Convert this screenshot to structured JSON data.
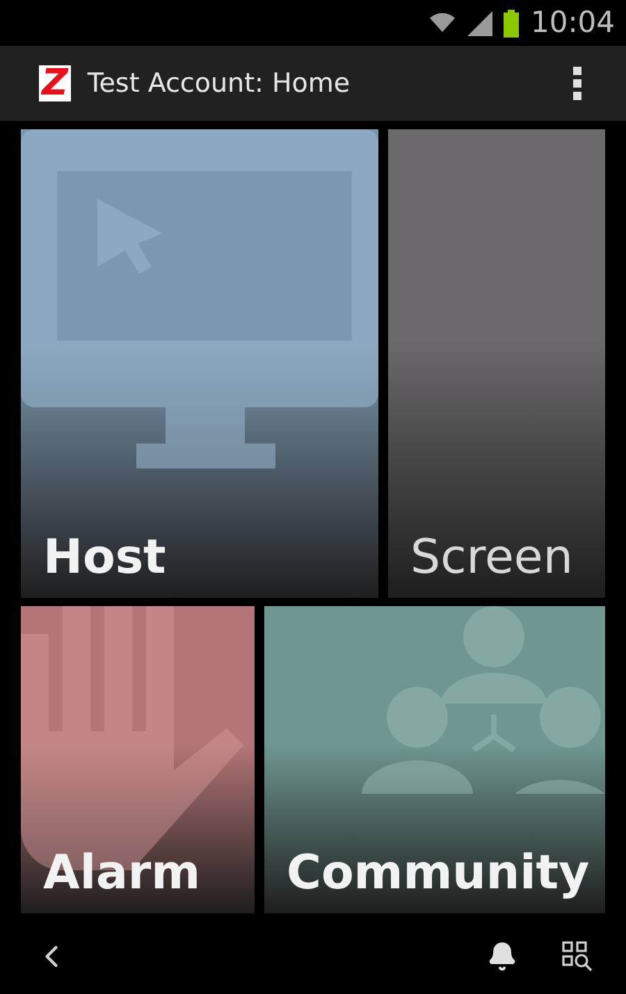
{
  "status_bar": {
    "time": "10:04"
  },
  "app_bar": {
    "logo": "Z",
    "title": "Test Account: Home"
  },
  "tiles": [
    {
      "label": "Host",
      "kind": "monitor",
      "color": "#7b98b0",
      "disabled": false
    },
    {
      "label": "Screen",
      "kind": "blank",
      "color": "#6b696b",
      "disabled": true
    },
    {
      "label": "Alarm",
      "kind": "hand",
      "color": "#b47576",
      "disabled": false
    },
    {
      "label": "Community",
      "kind": "people",
      "color": "#6f9690",
      "disabled": false
    }
  ]
}
